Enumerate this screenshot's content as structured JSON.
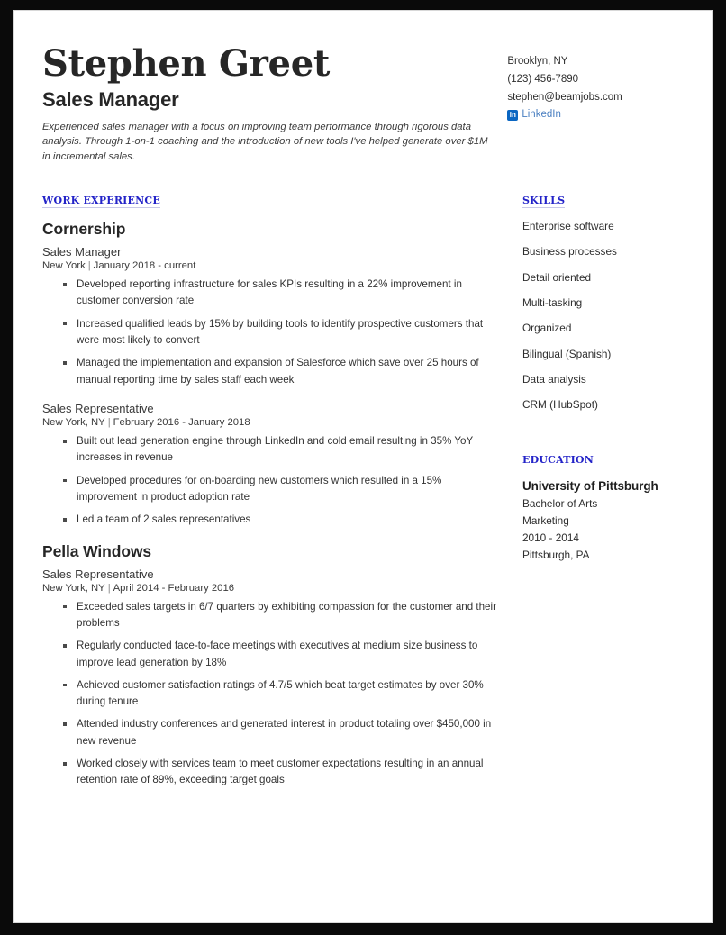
{
  "header": {
    "name": "Stephen Greet",
    "title": "Sales Manager",
    "summary": "Experienced sales manager with a focus on improving team performance through rigorous data analysis. Through 1-on-1 coaching and the introduction of new tools I've helped generate over $1M in incremental sales."
  },
  "contact": {
    "location": "Brooklyn, NY",
    "phone": "(123) 456-7890",
    "email": "stephen@beamjobs.com",
    "linkedin_label": "LinkedIn",
    "linkedin_badge": "in"
  },
  "sections": {
    "work_experience": "WORK EXPERIENCE",
    "skills": "SKILLS",
    "education": "EDUCATION"
  },
  "experience": [
    {
      "employer": "Cornership",
      "roles": [
        {
          "title": "Sales Manager",
          "location": "New York",
          "dates": "January 2018 - current",
          "bullets": [
            "Developed reporting infrastructure for sales KPIs resulting in a 22% improvement in customer conversion rate",
            "Increased qualified leads by 15% by building tools to identify prospective customers that were most likely to convert",
            "Managed the implementation and expansion of Salesforce which save over 25 hours of manual reporting time by sales staff each week"
          ]
        },
        {
          "title": "Sales Representative",
          "location": "New York, NY",
          "dates": "February 2016 - January 2018",
          "bullets": [
            "Built out lead generation engine through LinkedIn and cold email resulting in 35% YoY increases in revenue",
            "Developed procedures for on-boarding new customers which resulted in a 15% improvement in product adoption rate",
            "Led a team of 2 sales representatives"
          ]
        }
      ]
    },
    {
      "employer": "Pella Windows",
      "roles": [
        {
          "title": "Sales Representative",
          "location": "New York, NY",
          "dates": "April 2014 - February 2016",
          "bullets": [
            "Exceeded sales targets in 6/7 quarters by exhibiting compassion for the customer and their problems",
            "Regularly conducted face-to-face meetings with executives at medium size business to improve lead generation by 18%",
            "Achieved customer satisfaction ratings of 4.7/5 which beat target estimates by over 30% during tenure",
            "Attended industry conferences and generated interest in product totaling over $450,000 in new revenue",
            "Worked closely with services team to meet customer expectations resulting in an annual retention rate of 89%, exceeding target goals"
          ]
        }
      ]
    }
  ],
  "skills": [
    "Enterprise software",
    "Business processes",
    "Detail oriented",
    "Multi-tasking",
    "Organized",
    "Bilingual (Spanish)",
    "Data analysis",
    "CRM (HubSpot)"
  ],
  "education": {
    "school": "University of Pittsburgh",
    "degree": "Bachelor of Arts",
    "major": "Marketing",
    "years": "2010 - 2014",
    "location": "Pittsburgh, PA"
  },
  "colors": {
    "heading_blue": "#2323c8",
    "linkedin_blue": "#0a66c2",
    "link_text": "#4a7fc1",
    "text_dark": "#262626"
  }
}
